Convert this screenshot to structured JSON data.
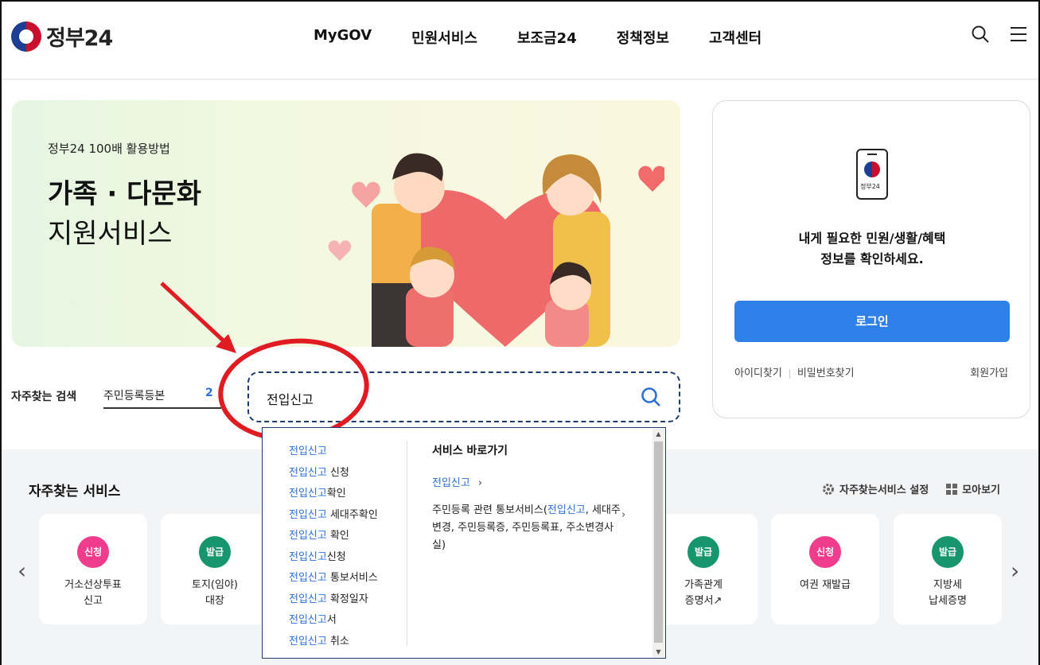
{
  "header": {
    "logo_text": "정부24",
    "nav": [
      "MyGOV",
      "민원서비스",
      "보조금24",
      "정책정보",
      "고객센터"
    ],
    "icons": [
      "search-icon",
      "hamburger-menu-icon"
    ]
  },
  "banner": {
    "subtitle": "정부24 100배 활용방법",
    "title_line1": "가족 · 다문화",
    "title_line2": "지원서비스"
  },
  "search": {
    "label": "자주찾는 검색",
    "select_value": "주민등록등본",
    "select_rank": "2",
    "query": "전입신고"
  },
  "dropdown": {
    "suggestions": [
      {
        "hl": "전입신고",
        "rest": ""
      },
      {
        "hl": "전입신고",
        "rest": " 신청"
      },
      {
        "hl": "전입신고",
        "rest": "확인"
      },
      {
        "hl": "전입신고",
        "rest": " 세대주확인"
      },
      {
        "hl": "전입신고",
        "rest": " 확인"
      },
      {
        "hl": "전입신고",
        "rest": "신청"
      },
      {
        "hl": "전입신고",
        "rest": " 통보서비스"
      },
      {
        "hl": "전입신고",
        "rest": " 확정일자"
      },
      {
        "hl": "전입신고",
        "rest": "서"
      },
      {
        "hl": "전입신고",
        "rest": " 취소"
      }
    ],
    "shortcut_heading": "서비스 바로가기",
    "shortcut_link": "전입신고",
    "shortcut_desc_before": "주민등록 관련 통보서비스(",
    "shortcut_desc_hl": "전입신고",
    "shortcut_desc_after": ", 세대주변경, 주민등록증, 주민등록표, 주소변경사실)"
  },
  "login": {
    "phone_label": "정부24",
    "message_line1": "내게 필요한 민원/생활/혜택",
    "message_line2": "정보를 확인하세요.",
    "login_button": "로그인",
    "find_id": "아이디찾기",
    "find_pw": "비밀번호찾기",
    "join": "회원가입"
  },
  "favorites": {
    "title": "자주찾는 서비스",
    "settings_label": "자주찾는서비스 설정",
    "view_all_label": "모아보기",
    "cards": [
      {
        "badge": "신청",
        "type": "apply",
        "label": "거소선상투표\n신고"
      },
      {
        "badge": "발급",
        "type": "issue",
        "label": "토지(임야)\n대장"
      },
      {
        "badge": "발급",
        "type": "issue",
        "label": "가족관계\n증명서↗"
      },
      {
        "badge": "신청",
        "type": "apply",
        "label": "여권 재발급"
      },
      {
        "badge": "발급",
        "type": "issue",
        "label": "지방세\n납세증명"
      }
    ]
  }
}
